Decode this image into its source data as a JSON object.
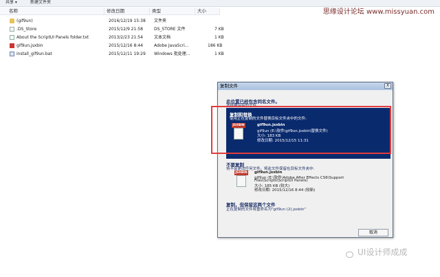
{
  "toolbar": {
    "share": "共享 ▾",
    "new_folder": "新建文件夹"
  },
  "watermark": {
    "text": "思缘设计论坛 www.missyuan.com"
  },
  "columns": {
    "name": "名称",
    "modified": "修改日期",
    "type": "类型",
    "size": "大小"
  },
  "files": [
    {
      "name": "(gif9un)",
      "modified": "2016/12/19 15:38",
      "type": "文件夹",
      "size": "",
      "icon": "folder"
    },
    {
      "name": ".DS_Store",
      "modified": "2015/12/9 21:58",
      "type": "DS_STORE 文件",
      "size": "7 KB",
      "icon": "doc"
    },
    {
      "name": "About the ScriptUI Panels folder.txt",
      "modified": "2013/2/23 21:54",
      "type": "文本文档",
      "size": "1 KB",
      "icon": "txt"
    },
    {
      "name": "gif9un.jsxbin",
      "modified": "2015/12/16 8:44",
      "type": "Adobe JavaScri...",
      "size": "186 KB",
      "icon": "jsx"
    },
    {
      "name": "install_gif9un.bat",
      "modified": "2015/12/11 19:29",
      "type": "Windows 批处理...",
      "size": "1 KB",
      "icon": "bat"
    }
  ],
  "dialog": {
    "title": "复制文件",
    "close": "X",
    "heading": "此位置已经包含同名文件。",
    "subheading": "选择要保留的文件",
    "option1": {
      "title": "复制和替换",
      "desc": "使用正在复制的文件替换目标文件夹中的文件:",
      "badge": "JSXBIN",
      "file": "gif9un.jsxbin",
      "path": "gif9un (E:\\软件\\gif9un.jsxbin\\替换文件)",
      "size": "大小: 183 KB",
      "date": "修改日期: 2015/12/15 11:31"
    },
    "option2": {
      "title": "不要复制",
      "desc": "将不会更改任何文件。将此文件保留在目标文件夹中:",
      "badge": "JSXBIN",
      "file": "gif9un.jsxbin",
      "path1": "gif9un (E:\\软件\\Adobe After Effects CS6\\Support",
      "path2": "Files\\Scripts\\ScriptUI Panels)",
      "size": "大小: 185 KB (较大)",
      "date": "修改日期: 2015/12/16 8:44 (较新)"
    },
    "option3": {
      "title": "复制，但保留这两个文件",
      "desc": "正在复制的文件将重命名为\"gif9un (2).jsxbin\""
    },
    "cancel": "取消"
  },
  "footer": {
    "brand": "UI设计师成成"
  }
}
